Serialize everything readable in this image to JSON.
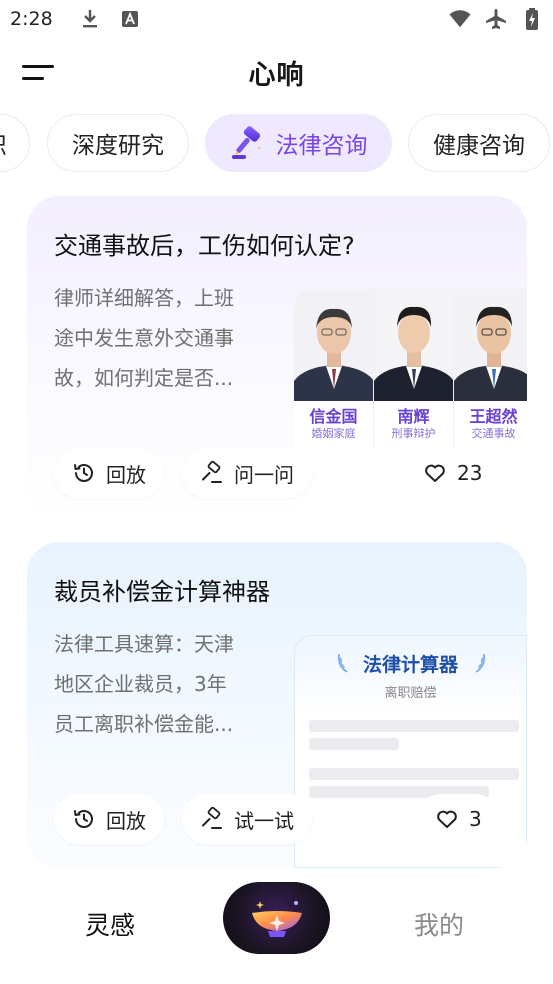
{
  "status_bar": {
    "time": "2:28"
  },
  "header": {
    "title": "心响"
  },
  "tabs": [
    {
      "label": "识",
      "active": false
    },
    {
      "label": "深度研究",
      "active": false
    },
    {
      "label": "法律咨询",
      "active": true,
      "icon": "gavel-icon"
    },
    {
      "label": "健康咨询",
      "active": false
    }
  ],
  "cards": [
    {
      "title": "交通事故后，工伤如何认定?",
      "desc_lines": [
        "律师详细解答，上班",
        "途中发生意外交通事",
        "故，如何判定是否..."
      ],
      "actions": [
        "回放",
        "问一问"
      ],
      "likes": "23",
      "lawyers": [
        {
          "name": "信金国",
          "field": "婚姻家庭"
        },
        {
          "name": "南辉",
          "field": "刑事辩护"
        },
        {
          "name": "王超然",
          "field": "交通事故"
        }
      ]
    },
    {
      "title": "裁员补偿金计算神器",
      "desc_lines": [
        "法律工具速算：天津",
        "地区企业裁员，3年",
        "员工离职补偿金能..."
      ],
      "actions": [
        "回放",
        "试一试"
      ],
      "likes": "3",
      "calculator": {
        "title": "法律计算器",
        "subtitle": "离职赔偿"
      }
    }
  ],
  "bottom_nav": {
    "left": "灵感",
    "right": "我的"
  },
  "colors": {
    "accent": "#7a45e8",
    "active_tab_bg": "#efe9ff",
    "calc_title": "#1f4fa8"
  }
}
